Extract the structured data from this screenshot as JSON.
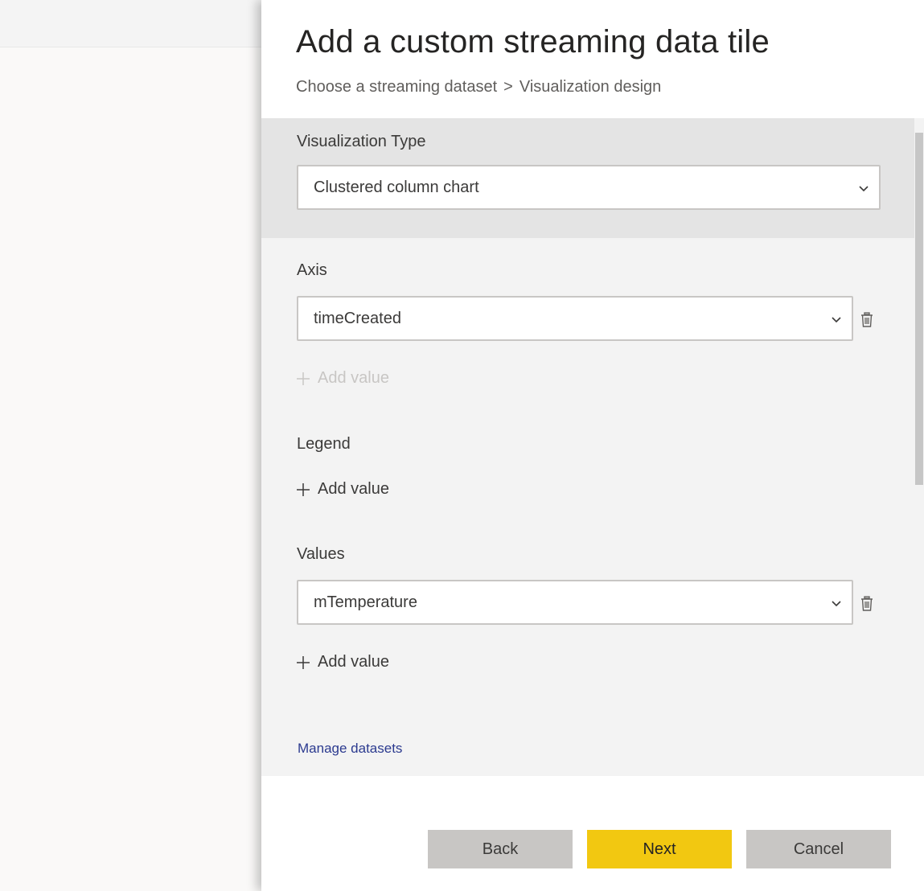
{
  "panel": {
    "title": "Add a custom streaming data tile",
    "breadcrumb": {
      "step1": "Choose a streaming dataset",
      "separator": ">",
      "step2": "Visualization design"
    }
  },
  "visualization_type": {
    "label": "Visualization Type",
    "selected": "Clustered column chart"
  },
  "axis": {
    "label": "Axis",
    "selected": "timeCreated",
    "add_value_label": "Add value",
    "add_value_enabled": false
  },
  "legend": {
    "label": "Legend",
    "add_value_label": "Add value"
  },
  "values": {
    "label": "Values",
    "selected": "mTemperature",
    "add_value_label": "Add value"
  },
  "manage_link": "Manage datasets",
  "buttons": {
    "back": "Back",
    "next": "Next",
    "cancel": "Cancel"
  },
  "icons": {
    "chevron": "chevron-down-icon",
    "trash": "trash-icon",
    "plus": "plus-icon"
  },
  "colors": {
    "primary_button": "#f2c811",
    "secondary_button": "#c8c6c4",
    "link": "#2b3a8f",
    "section_highlight": "#e4e4e4",
    "panel_body": "#f3f3f3"
  }
}
